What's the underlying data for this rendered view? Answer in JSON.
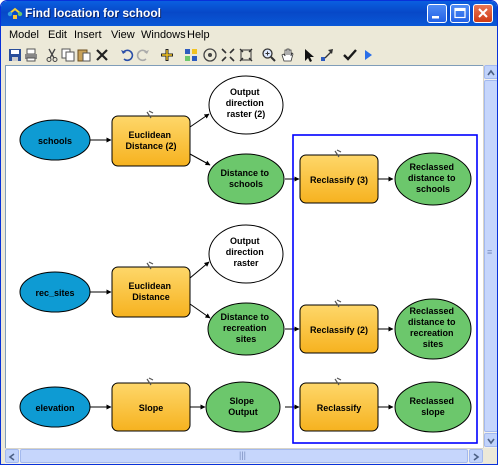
{
  "window": {
    "title": "Find location for school"
  },
  "menubar": {
    "items": [
      "Model",
      "Edit",
      "Insert",
      "View",
      "Windows",
      "Help"
    ]
  },
  "toolbar": {
    "icons": [
      "save-icon",
      "print-icon",
      "cut-icon",
      "copy-icon",
      "paste-icon",
      "delete-icon",
      "undo-icon",
      "redo-icon",
      "add-data-icon",
      "auto-layout-icon",
      "full-extent-icon",
      "fixed-zoom-in-icon",
      "fixed-zoom-out-icon",
      "zoom-in-icon",
      "pan-icon",
      "select-icon",
      "connect-icon",
      "validate-icon",
      "run-icon"
    ]
  },
  "colors": {
    "title_bar": "#0a5fe0",
    "input_data_fill": "#0e9bd3",
    "tool_fill": "#fbc437",
    "derived_data_fill": "#6cc76c",
    "output_empty_fill": "#ffffff",
    "selection_box": "#0000ff"
  },
  "model": {
    "row1": {
      "input": "schools",
      "tool": [
        "Euclidean",
        "Distance (2)"
      ],
      "output_raster": [
        "Output",
        "direction",
        "raster (2)"
      ],
      "derived": [
        "Distance to",
        "schools"
      ],
      "reclass_tool": "Reclassify (3)",
      "reclass_output": [
        "Reclassed",
        "distance to",
        "schools"
      ]
    },
    "row2": {
      "input": "rec_sites",
      "tool": [
        "Euclidean",
        "Distance"
      ],
      "output_raster": [
        "Output",
        "direction",
        "raster"
      ],
      "derived": [
        "Distance to",
        "recreation",
        "sites"
      ],
      "reclass_tool": "Reclassify (2)",
      "reclass_output": [
        "Reclassed",
        "distance to",
        "recreation",
        "sites"
      ]
    },
    "row3": {
      "input": "elevation",
      "tool": "Slope",
      "derived": [
        "Slope",
        "Output"
      ],
      "reclass_tool": "Reclassify",
      "reclass_output": [
        "Reclassed",
        "slope"
      ]
    }
  },
  "scrollbars": {
    "vertical_grip": "≡",
    "horizontal_grip": "|||"
  }
}
